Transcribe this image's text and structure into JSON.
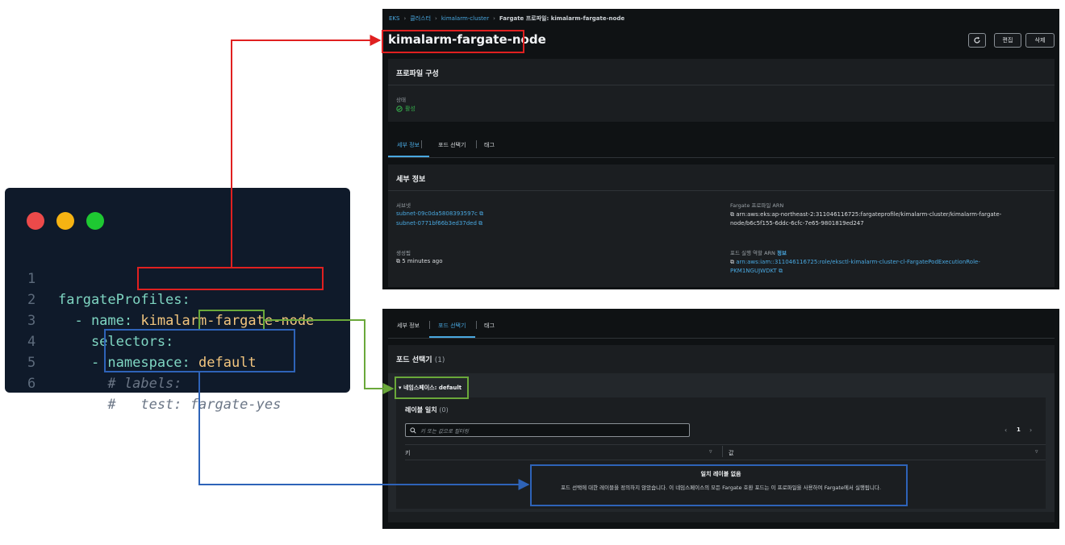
{
  "editor": {
    "dot_colors": [
      "#ec4a4a",
      "#f6b312",
      "#1ec832"
    ],
    "lines": [
      {
        "num": "1",
        "key": "fargateProfiles:",
        "value": "",
        "comment": ""
      },
      {
        "num": "2",
        "key": "  - name: ",
        "value": "kimalarm-fargate-node",
        "comment": ""
      },
      {
        "num": "3",
        "key": "    selectors:",
        "value": "",
        "comment": ""
      },
      {
        "num": "4",
        "key": "    - namespace: ",
        "value": "default",
        "comment": ""
      },
      {
        "num": "5",
        "key": "",
        "value": "",
        "comment": "      # labels:"
      },
      {
        "num": "6",
        "key": "",
        "value": "",
        "comment": "      #   test: fargate-yes"
      }
    ]
  },
  "console_top": {
    "breadcrumb": [
      "EKS",
      "클러스터",
      "kimalarm-cluster",
      "Fargate 프로파일: kimalarm-fargate-node"
    ],
    "page_title": "kimalarm-fargate-node",
    "refresh_icon": "refresh-icon",
    "edit_label": "편집",
    "delete_label": "삭제",
    "profile_config_title": "프로파일 구성",
    "status_label": "상태",
    "status_value": "활성",
    "tabs": [
      "세부 정보",
      "포드 선택기",
      "태그"
    ],
    "details_title": "세부 정보",
    "subnets_label": "서브넷",
    "subnets": [
      "subnet-09c0da5808393597c",
      "subnet-0771bf66b3ed37ded"
    ],
    "created_label": "생성됨",
    "created_value": "5 minutes ago",
    "arn_label": "Fargate 프로파일 ARN",
    "arn_value_1": "arn:aws:eks:ap-northeast-2:311046116725:fargateprofile/kimalarm-cluster/kimalarm-fargate-",
    "arn_value_2": "node/b6c5f155-6ddc-6cfc-7e65-9801819ed247",
    "role_label": "포드 실행 역할 ARN",
    "role_info": "정보",
    "role_value_1": "arn:aws:iam::311046116725:role/eksctl-kimalarm-cluster-cl-FargatePodExecutionRole-",
    "role_value_2": "PKM1NGUJWDKT"
  },
  "console_bottom": {
    "tabs": [
      "세부 정보",
      "포드 선택기",
      "태그"
    ],
    "selector_title": "포드 선택기",
    "selector_count": "(1)",
    "namespace_label": "네임스페이스: default",
    "label_match_title": "레이블 일치",
    "label_match_count": "(0)",
    "search_placeholder": "키 또는 값으로 필터링",
    "page_number": "1",
    "col_key": "키",
    "col_value": "값",
    "empty_title": "일치 레이블 없음",
    "empty_desc": "포드 선택에 대한 레이블을 정의하지 않았습니다. 이 네임스페이스의 모든 Fargate 호환 포드는 이 프로파일을 사용하여 Fargate에서 실행됩니다."
  },
  "annotation_colors": {
    "red": "#e02020",
    "green": "#6aa83a",
    "blue": "#2e63b8"
  }
}
